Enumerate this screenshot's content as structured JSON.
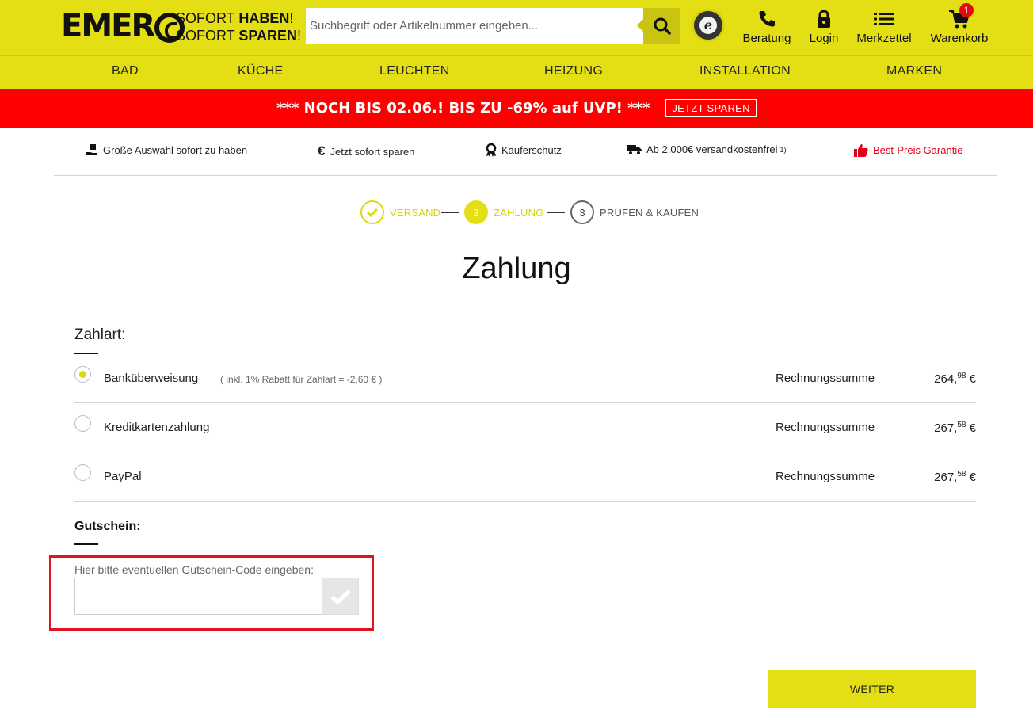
{
  "header": {
    "logo": "EMER",
    "slogan_line1_a": "SOFORT ",
    "slogan_line1_b": "HABEN",
    "slogan_line1_c": "!",
    "slogan_line2_a": "SOFORT ",
    "slogan_line2_b": "SPAREN",
    "slogan_line2_c": "!",
    "search_placeholder": "Suchbegriff oder Artikelnummer eingeben...",
    "trusted_badge_letter": "e",
    "icons": [
      {
        "label": "Beratung",
        "icon": "phone-icon"
      },
      {
        "label": "Login",
        "icon": "lock-icon"
      },
      {
        "label": "Merkzettel",
        "icon": "list-icon"
      },
      {
        "label": "Warenkorb",
        "icon": "cart-icon",
        "badge": "1"
      }
    ],
    "brand_color": "#e4df14"
  },
  "nav": [
    "BAD",
    "KÜCHE",
    "LEUCHTEN",
    "HEIZUNG",
    "INSTALLATION",
    "MARKEN"
  ],
  "promo": {
    "text": "*** NOCH BIS 02.06.! BIS ZU -69% auf UVP! ***",
    "button": "JETZT SPAREN",
    "color": "#ff0000"
  },
  "usps": [
    {
      "text": "Große Auswahl sofort zu haben",
      "icon": "hand-box-icon"
    },
    {
      "text": "Jetzt sofort sparen",
      "icon": "euro-icon"
    },
    {
      "text": "Käuferschutz",
      "icon": "award-icon"
    },
    {
      "text": "Ab 2.000€ versandkostenfrei",
      "sup": "1)",
      "icon": "truck-icon"
    },
    {
      "text": "Best-Preis Garantie",
      "icon": "thumbs-up-icon"
    }
  ],
  "steps": [
    {
      "number": "",
      "label": "VERSAND",
      "state": "done"
    },
    {
      "number": "2",
      "label": "ZAHLUNG",
      "state": "active"
    },
    {
      "number": "3",
      "label": "PRÜFEN & KAUFEN",
      "state": "todo"
    }
  ],
  "page_title": "Zahlung",
  "payment": {
    "section_title": "Zahlart:",
    "methods": [
      {
        "name": "Banküberweisung",
        "note": "( inkl. 1% Rabatt für Zahlart = -2,60 € )",
        "sum_label": "Rechnungssumme",
        "price_main": "264,",
        "price_cents": "98",
        "currency": " €",
        "selected": true
      },
      {
        "name": "Kreditkartenzahlung",
        "note": "",
        "sum_label": "Rechnungssumme",
        "price_main": "267,",
        "price_cents": "58",
        "currency": " €",
        "selected": false
      },
      {
        "name": "PayPal",
        "note": "",
        "sum_label": "Rechnungssumme",
        "price_main": "267,",
        "price_cents": "58",
        "currency": " €",
        "selected": false
      }
    ]
  },
  "voucher": {
    "title": "Gutschein:",
    "label": "Hier bitte eventuellen Gutschein-Code eingeben:",
    "value": ""
  },
  "next_button": "WEITER"
}
